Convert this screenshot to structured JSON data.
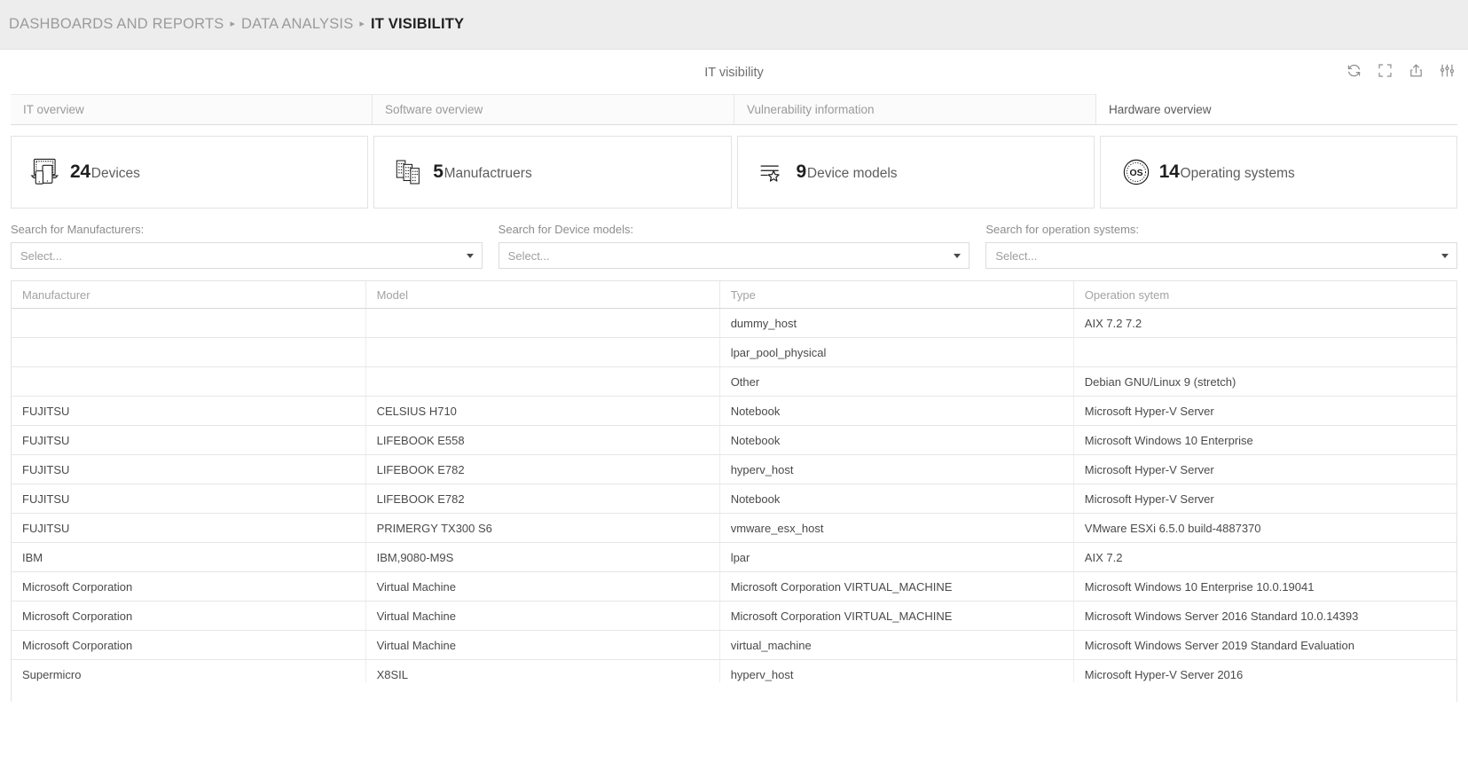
{
  "breadcrumb": {
    "separator": "▸",
    "items": [
      {
        "label": "DASHBOARDS AND REPORTS",
        "active": false
      },
      {
        "label": "DATA ANALYSIS",
        "active": false
      },
      {
        "label": "IT VISIBILITY",
        "active": true
      }
    ]
  },
  "panel": {
    "title": "IT visibility",
    "tools": [
      {
        "name": "refresh-icon",
        "tooltip": "Refresh"
      },
      {
        "name": "fullscreen-icon",
        "tooltip": "Fullscreen"
      },
      {
        "name": "export-icon",
        "tooltip": "Export"
      },
      {
        "name": "settings-sliders-icon",
        "tooltip": "Settings"
      }
    ]
  },
  "tabs": [
    {
      "label": "IT overview",
      "active": false
    },
    {
      "label": "Software overview",
      "active": false
    },
    {
      "label": "Vulnerability information",
      "active": false
    },
    {
      "label": "Hardware overview",
      "active": true
    }
  ],
  "kpi_cards": [
    {
      "value": "24",
      "label": "Devices",
      "icon": "devices-icon"
    },
    {
      "value": "5",
      "label": "Manufactruers",
      "icon": "buildings-icon"
    },
    {
      "value": "9",
      "label": "Device models",
      "icon": "list-star-icon"
    },
    {
      "value": "14",
      "label": "Operating systems",
      "icon": "os-badge-icon"
    }
  ],
  "filters": [
    {
      "label": "Search for Manufacturers:",
      "placeholder": "Select...",
      "value": "Select..."
    },
    {
      "label": "Search for Device models:",
      "placeholder": "Select...",
      "value": "Select..."
    },
    {
      "label": "Search for operation systems:",
      "placeholder": "Select...",
      "value": "Select..."
    }
  ],
  "table": {
    "columns": [
      "Manufacturer",
      "Model",
      "Type",
      "Operation sytem"
    ],
    "rows": [
      [
        "",
        "",
        "dummy_host",
        "AIX 7.2 7.2"
      ],
      [
        "",
        "",
        "lpar_pool_physical",
        ""
      ],
      [
        "",
        "",
        "Other",
        "Debian GNU/Linux 9 (stretch)"
      ],
      [
        "FUJITSU",
        "CELSIUS H710",
        "Notebook",
        "Microsoft Hyper-V Server"
      ],
      [
        "FUJITSU",
        "LIFEBOOK E558",
        "Notebook",
        "Microsoft Windows 10 Enterprise"
      ],
      [
        "FUJITSU",
        "LIFEBOOK E782",
        "hyperv_host",
        "Microsoft Hyper-V Server"
      ],
      [
        "FUJITSU",
        "LIFEBOOK E782",
        "Notebook",
        "Microsoft Hyper-V Server"
      ],
      [
        "FUJITSU",
        "PRIMERGY TX300 S6",
        "vmware_esx_host",
        "VMware ESXi 6.5.0 build-4887370"
      ],
      [
        "IBM",
        "IBM,9080-M9S",
        "lpar",
        "AIX 7.2"
      ],
      [
        "Microsoft Corporation",
        "Virtual Machine",
        "Microsoft Corporation VIRTUAL_MACHINE",
        "Microsoft Windows 10 Enterprise 10.0.19041"
      ],
      [
        "Microsoft Corporation",
        "Virtual Machine",
        "Microsoft Corporation VIRTUAL_MACHINE",
        "Microsoft Windows Server 2016 Standard 10.0.14393"
      ],
      [
        "Microsoft Corporation",
        "Virtual Machine",
        "virtual_machine",
        "Microsoft Windows Server 2019 Standard Evaluation"
      ],
      [
        "Supermicro",
        "X8SIL",
        "hyperv_host",
        "Microsoft Hyper-V Server 2016"
      ],
      [
        "",
        "",
        "",
        ""
      ]
    ]
  },
  "colors": {
    "breadcrumb_bg": "#ededed",
    "panel_bg": "#ffffff",
    "muted_text": "#9b9b9b",
    "active_text": "#222222",
    "border": "#e3e3e3"
  }
}
